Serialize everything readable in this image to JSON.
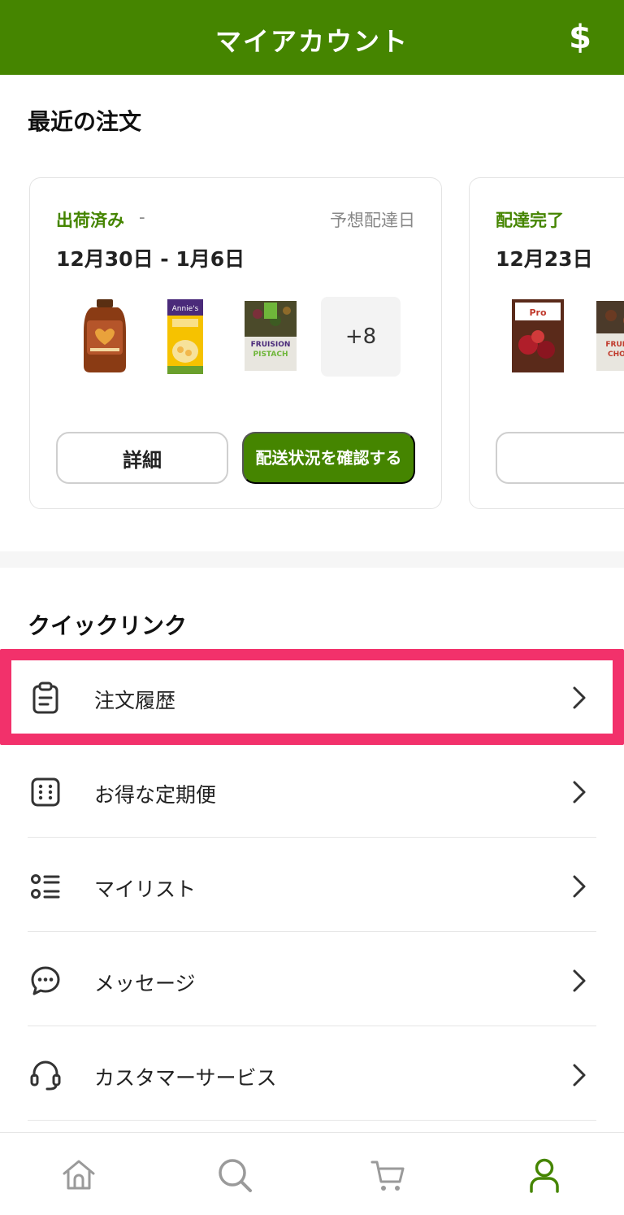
{
  "header": {
    "title": "マイアカウント",
    "currency_icon": "dollar-sign-icon"
  },
  "recent_orders": {
    "title": "最近の注文",
    "orders": [
      {
        "status": "出荷済み",
        "status_separator": "-",
        "eta_label": "予想配達日",
        "date": "12月30日 - 1月6日",
        "products": [
          "honey-bottle-thumb",
          "mac-and-cheese-box-thumb",
          "fruit-pops-bag-thumb"
        ],
        "more_count": "+8",
        "details_label": "詳細",
        "track_label": "配送状況を確認する"
      },
      {
        "status": "配達完了",
        "date": "12月23日",
        "products": [
          "granola-bag-thumb",
          "choco-snack-bag-thumb"
        ]
      }
    ]
  },
  "quick_links": {
    "title": "クイックリンク",
    "items": [
      {
        "label": "注文履歴",
        "icon": "clipboard-icon"
      },
      {
        "label": "お得な定期便",
        "icon": "calendar-grid-icon"
      },
      {
        "label": "マイリスト",
        "icon": "list-icon"
      },
      {
        "label": "メッセージ",
        "icon": "chat-bubble-icon"
      },
      {
        "label": "カスタマーサービス",
        "icon": "headset-icon"
      }
    ]
  },
  "bottom_nav": {
    "items": [
      {
        "icon": "home-icon"
      },
      {
        "icon": "search-icon"
      },
      {
        "icon": "cart-icon"
      },
      {
        "icon": "account-icon",
        "active": true
      }
    ],
    "active_color": "#458500",
    "inactive_color": "#9a9a9a"
  },
  "colors": {
    "brand": "#458500",
    "highlight": "#f2316b"
  }
}
